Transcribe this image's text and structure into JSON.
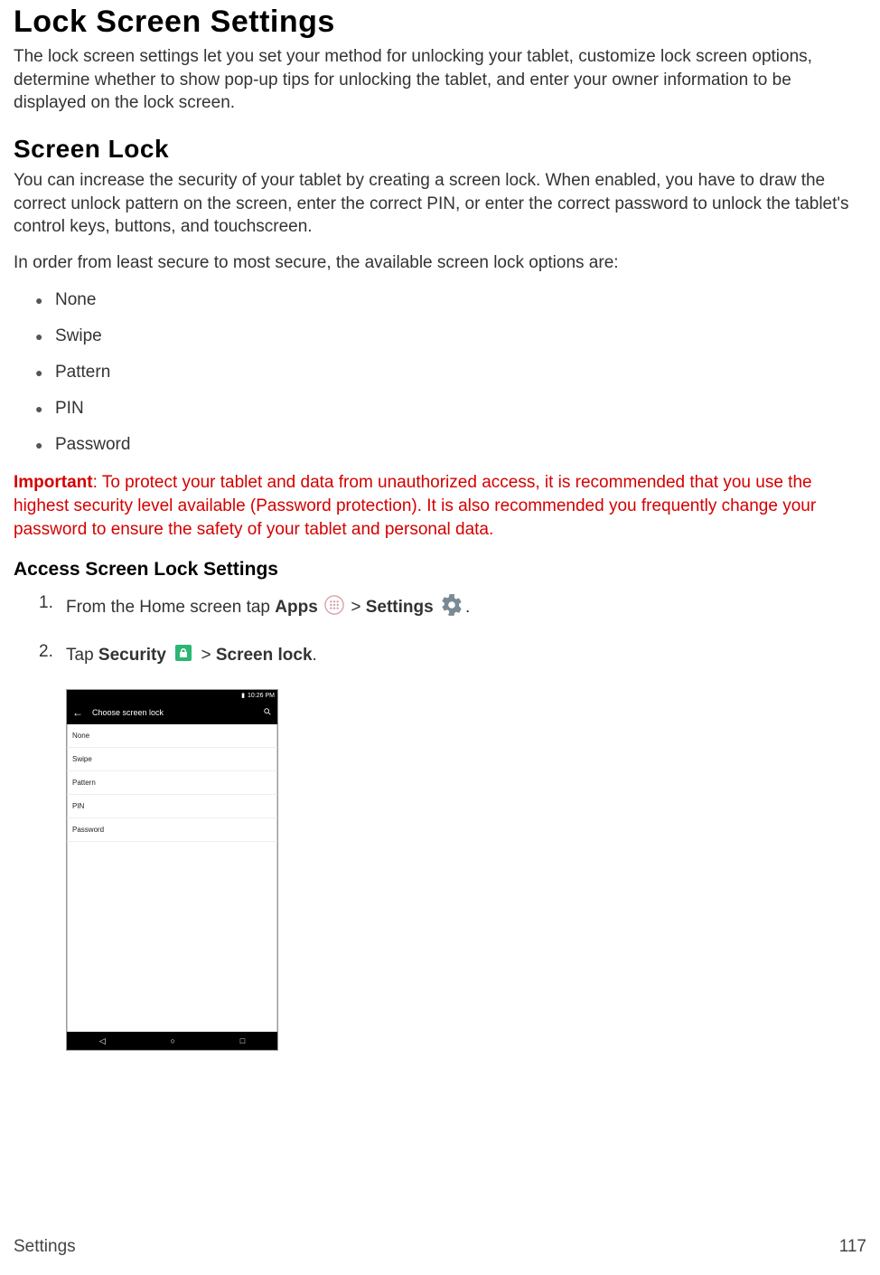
{
  "title_main": "Lock Screen Settings",
  "intro_main": "The lock screen settings let you set your method for unlocking your tablet, customize lock screen options, determine whether to show pop-up tips for unlocking the tablet, and enter your owner information to be displayed on the lock screen.",
  "title_screen_lock": "Screen Lock",
  "intro_screen_lock": "You can increase the security of your tablet by creating a screen lock. When enabled, you have to draw the correct unlock pattern on the screen, enter the correct PIN, or enter the correct password to unlock the tablet's control keys, buttons, and touchscreen.",
  "options_lead": "In order from least secure to most secure, the available screen lock options are:",
  "options": [
    "None",
    "Swipe",
    "Pattern",
    "PIN",
    "Password"
  ],
  "important_label": "Important",
  "important_text": ": To protect your tablet and data from unauthorized access, it is recommended that you use the highest security level available (Password protection). It is also recommended you frequently change your password to ensure the safety of your tablet and personal data.",
  "access_heading": "Access Screen Lock Settings",
  "steps": {
    "step1": {
      "prefix": "From the Home screen tap ",
      "apps_label": "Apps",
      "sep1": " > ",
      "settings_label": "Settings",
      "suffix": "."
    },
    "step2": {
      "prefix": "Tap ",
      "security_label": "Security",
      "sep1": " > ",
      "screen_lock_label": "Screen lock",
      "suffix": "."
    }
  },
  "phone": {
    "status_time": "10:26 PM",
    "header_title": "Choose screen lock",
    "list": [
      "None",
      "Swipe",
      "Pattern",
      "PIN",
      "Password"
    ]
  },
  "footer_left": "Settings",
  "footer_right": "117"
}
